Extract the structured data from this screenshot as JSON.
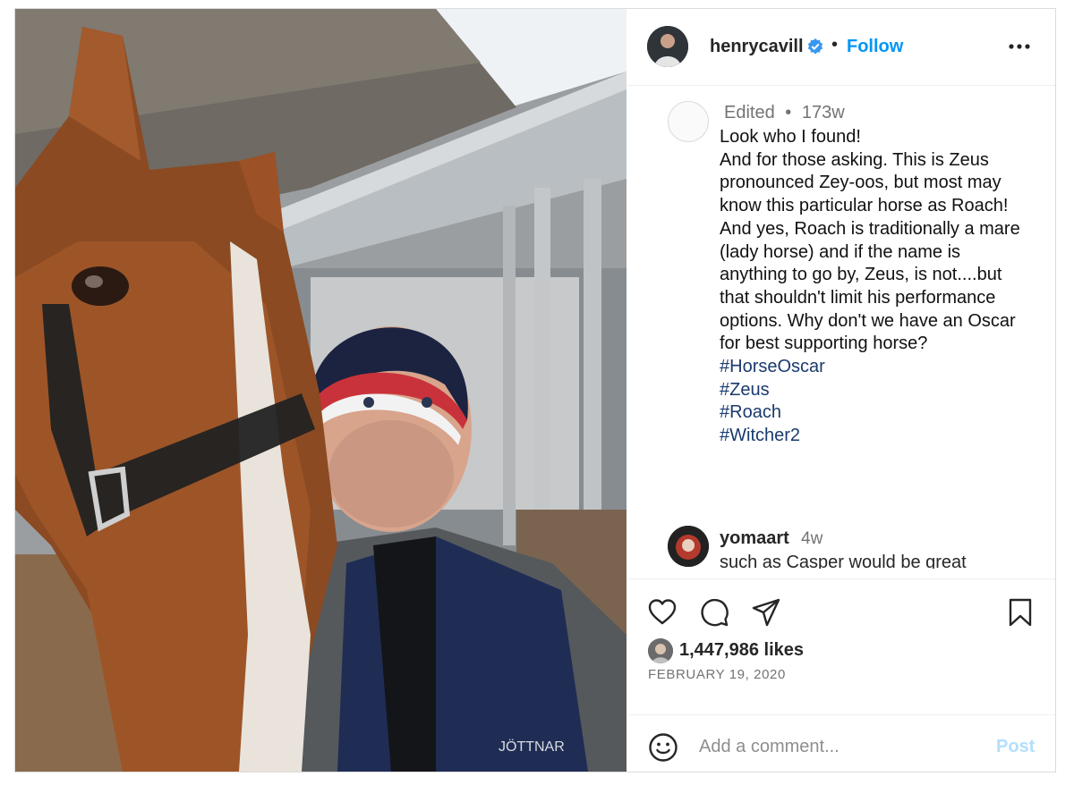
{
  "post": {
    "username": "henrycavill",
    "separator": "•",
    "follow_label": "Follow",
    "verified_color": "#3897f0",
    "photo_description_icon": "horse-selfie-photo"
  },
  "caption": {
    "edited_label": "Edited",
    "meta_separator": "•",
    "age": "173w",
    "lines": [
      "Look who I found!",
      "And for those asking. This is Zeus pronounced Zey-oos, but most may know this particular horse as Roach! And yes, Roach is traditionally a mare (lady horse) and if the name is anything to go by, Zeus, is not....but that shouldn't limit his performance options. Why don't we have an Oscar for best supporting horse?"
    ],
    "hashtags": [
      "#HorseOscar",
      "#Zeus",
      "#Roach",
      "#Witcher2"
    ]
  },
  "comment": {
    "username": "yomaart",
    "age": "4w",
    "text": "such as Casper would be great"
  },
  "engagement": {
    "likes": "1,447,986 likes",
    "date": "FEBRUARY 19, 2020"
  },
  "add_comment": {
    "placeholder": "Add a comment...",
    "post_label": "Post"
  },
  "colors": {
    "accent": "#0095f6",
    "hashtag": "#1a3a6e",
    "post_disabled": "#b2dffc"
  }
}
